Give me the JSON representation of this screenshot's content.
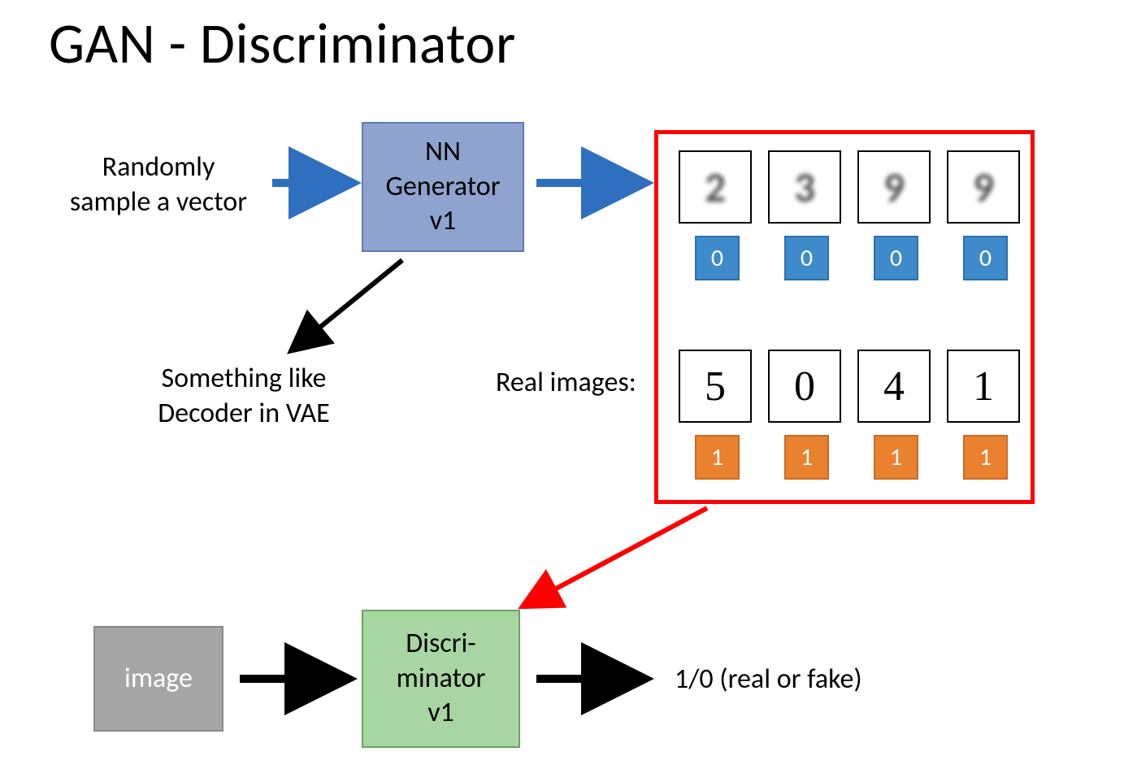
{
  "title": "GAN - Discriminator",
  "labels": {
    "random_vector_line1": "Randomly",
    "random_vector_line2": "sample a vector",
    "decoder_note_line1": "Something like",
    "decoder_note_line2": "Decoder in VAE",
    "real_images": "Real images:",
    "output_text": "1/0   (real or fake)"
  },
  "boxes": {
    "generator_line1": "NN",
    "generator_line2": "Generator",
    "generator_line3": "v1",
    "discriminator_line1": "Discri-",
    "discriminator_line2": "minator",
    "discriminator_line3": "v1",
    "image_placeholder": "image"
  },
  "fake_row": {
    "digits": [
      "2",
      "3",
      "9",
      "9"
    ],
    "labels": [
      "0",
      "0",
      "0",
      "0"
    ]
  },
  "real_row": {
    "digits": [
      "5",
      "0",
      "4",
      "1"
    ],
    "labels": [
      "1",
      "1",
      "1",
      "1"
    ]
  },
  "colors": {
    "blue_arrow": "#2f6fbf",
    "black_arrow": "#000000",
    "red_arrow": "#ff0000"
  }
}
